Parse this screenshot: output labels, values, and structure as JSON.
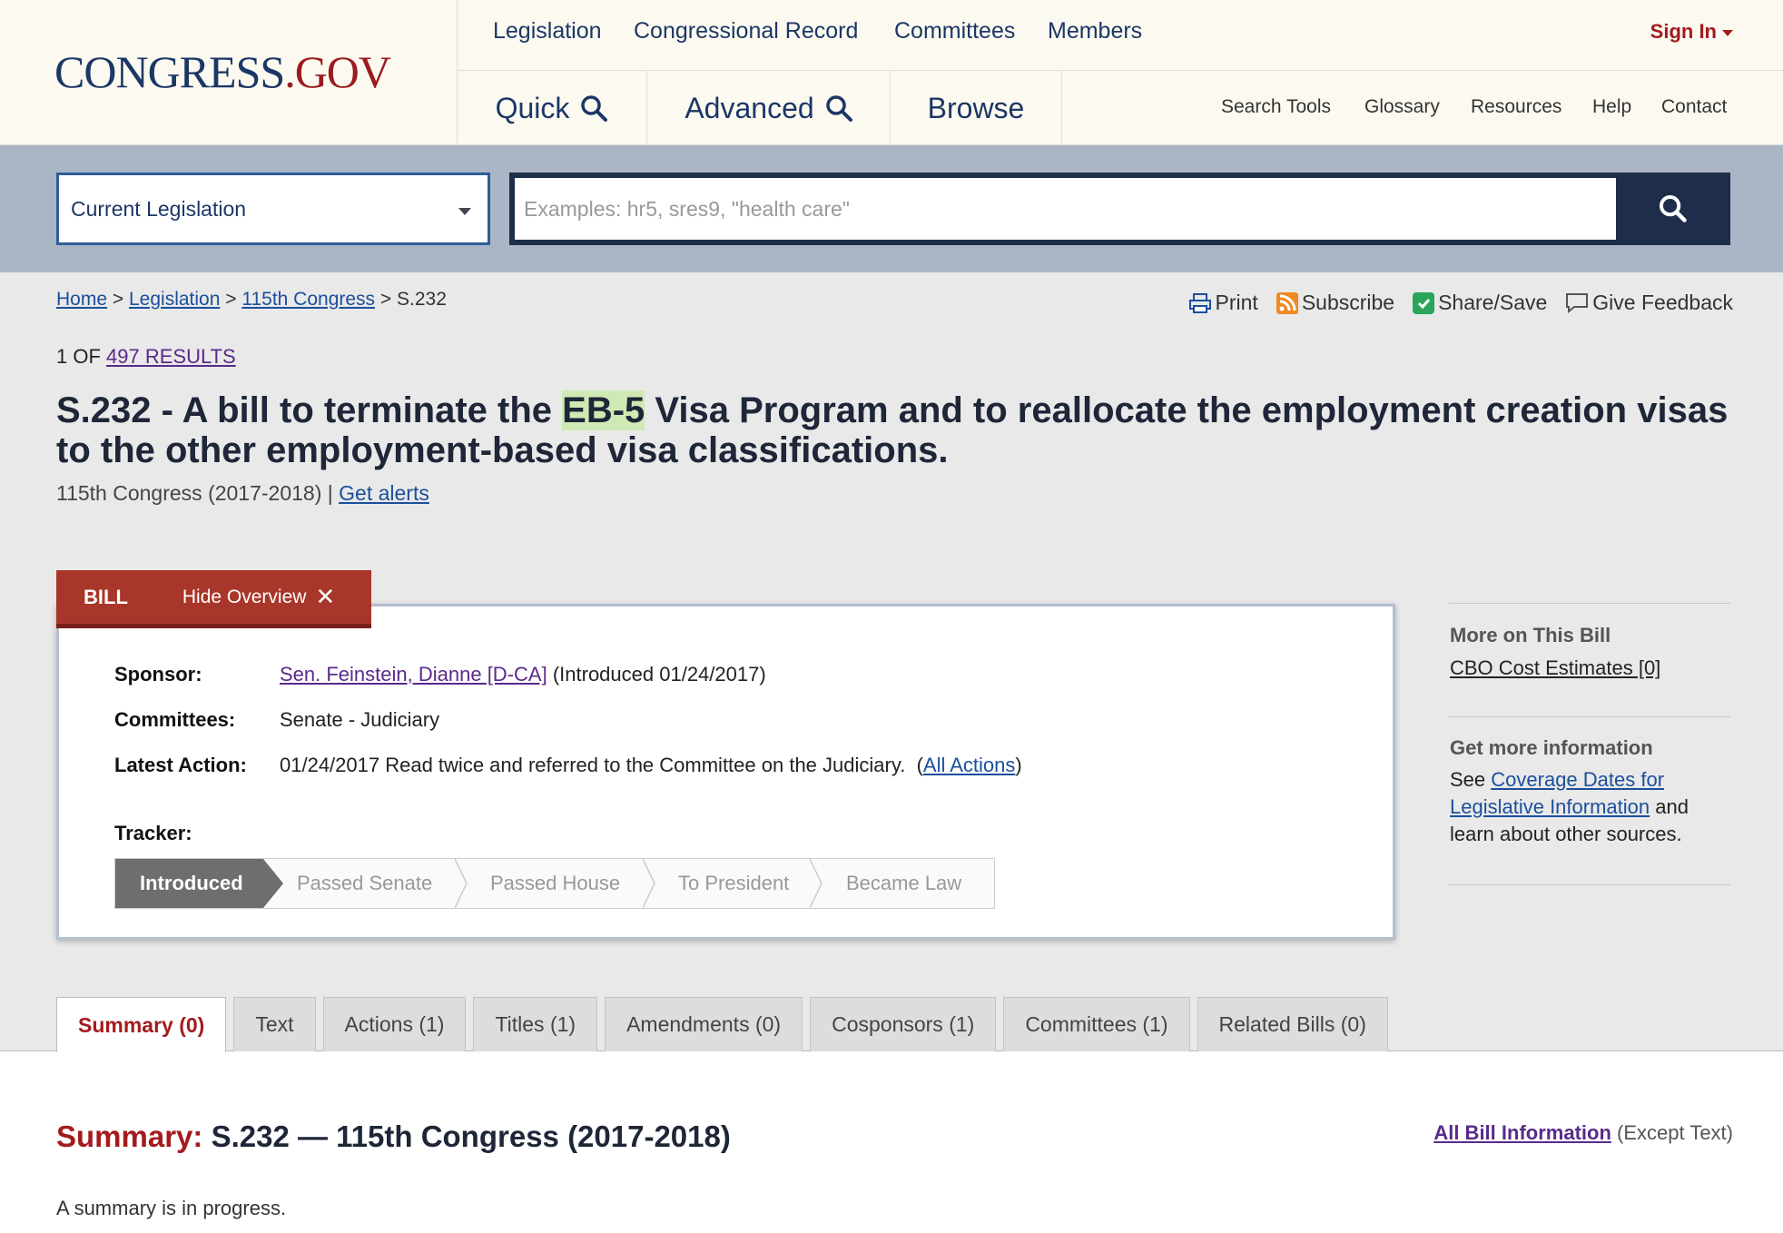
{
  "header": {
    "logo_main": "CONGRESS",
    "logo_dot": ".",
    "logo_gov": "GOV",
    "topnav": [
      "Legislation",
      "Congressional Record",
      "Committees",
      "Members"
    ],
    "sign_in": "Sign In",
    "bignav": {
      "quick": "Quick",
      "advanced": "Advanced",
      "browse": "Browse"
    },
    "utility": [
      "Search Tools",
      "Glossary",
      "Resources",
      "Help",
      "Contact"
    ]
  },
  "search": {
    "scope": "Current Legislation",
    "placeholder": "Examples: hr5, sres9, \"health care\""
  },
  "breadcrumb": {
    "home": "Home",
    "sep": ">",
    "legislation": "Legislation",
    "congress": "115th Congress",
    "current": "S.232"
  },
  "toolbar": {
    "print": "Print",
    "subscribe": "Subscribe",
    "share": "Share/Save",
    "feedback": "Give Feedback"
  },
  "results": {
    "prefix": "1 OF",
    "link": "497 RESULTS"
  },
  "bill": {
    "title_pre": "S.232 - A bill to terminate the ",
    "title_hl": "EB-5",
    "title_post": " Visa Program and to reallocate the employment creation visas to the other employment-based visa classifications.",
    "congress": "115th Congress (2017-2018) |",
    "alerts": "Get alerts"
  },
  "overview": {
    "tab_label": "BILL",
    "hide_label": "Hide Overview",
    "sponsor_label": "Sponsor:",
    "sponsor_name": "Sen. Feinstein, Dianne [D-CA]",
    "sponsor_date": "(Introduced 01/24/2017)",
    "committees_label": "Committees:",
    "committees": "Senate - Judiciary",
    "latest_label": "Latest Action:",
    "latest": "01/24/2017 Read twice and referred to the Committee on the Judiciary.",
    "all_actions_open": "(",
    "all_actions": "All Actions",
    "all_actions_close": ")",
    "tracker_label": "Tracker:",
    "tracker": [
      "Introduced",
      "Passed Senate",
      "Passed House",
      "To President",
      "Became Law"
    ]
  },
  "sidebar": {
    "more_heading": "More on This Bill",
    "cbo": "CBO Cost Estimates [0]",
    "info_heading": "Get more information",
    "see": "See",
    "coverage_link": "Coverage Dates for Legislative Information",
    "and_text": "and learn about other sources."
  },
  "tabs": [
    "Summary (0)",
    "Text",
    "Actions (1)",
    "Titles (1)",
    "Amendments (0)",
    "Cosponsors (1)",
    "Committees (1)",
    "Related Bills (0)"
  ],
  "summary": {
    "label": "Summary:",
    "title": "S.232 — 115th Congress (2017-2018)",
    "all_info": "All Bill Information",
    "except": "(Except Text)",
    "text": "A summary is in progress."
  },
  "colors": {
    "navy": "#1c3766",
    "red": "#a31b1e",
    "billtab": "#a9362a"
  }
}
